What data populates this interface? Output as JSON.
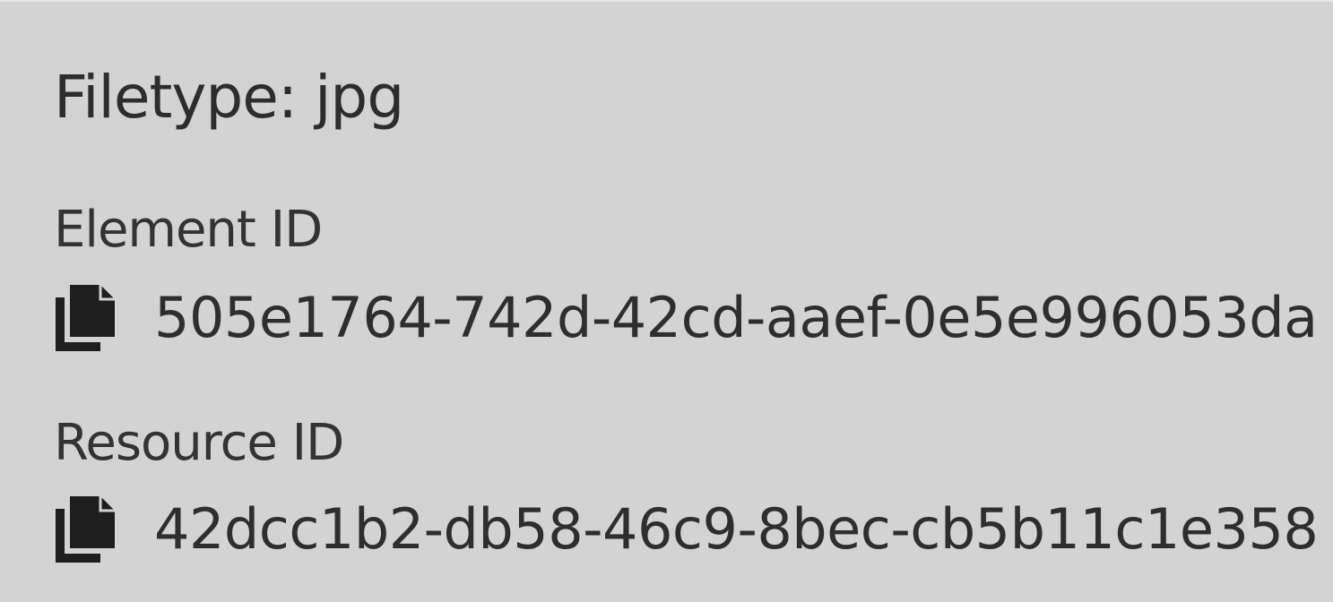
{
  "details": {
    "filetype_label": "Filetype: jpg",
    "element_id": {
      "label": "Element ID",
      "value": "505e1764-742d-42cd-aaef-0e5e996053da",
      "icon": "copy-icon"
    },
    "resource_id": {
      "label": "Resource ID",
      "value": "42dcc1b2-db58-46c9-8bec-cb5b11c1e358",
      "icon": "copy-icon"
    }
  },
  "colors": {
    "background": "#d3d3d3",
    "text": "#2d2d2d",
    "icon": "#1e1e1e"
  }
}
